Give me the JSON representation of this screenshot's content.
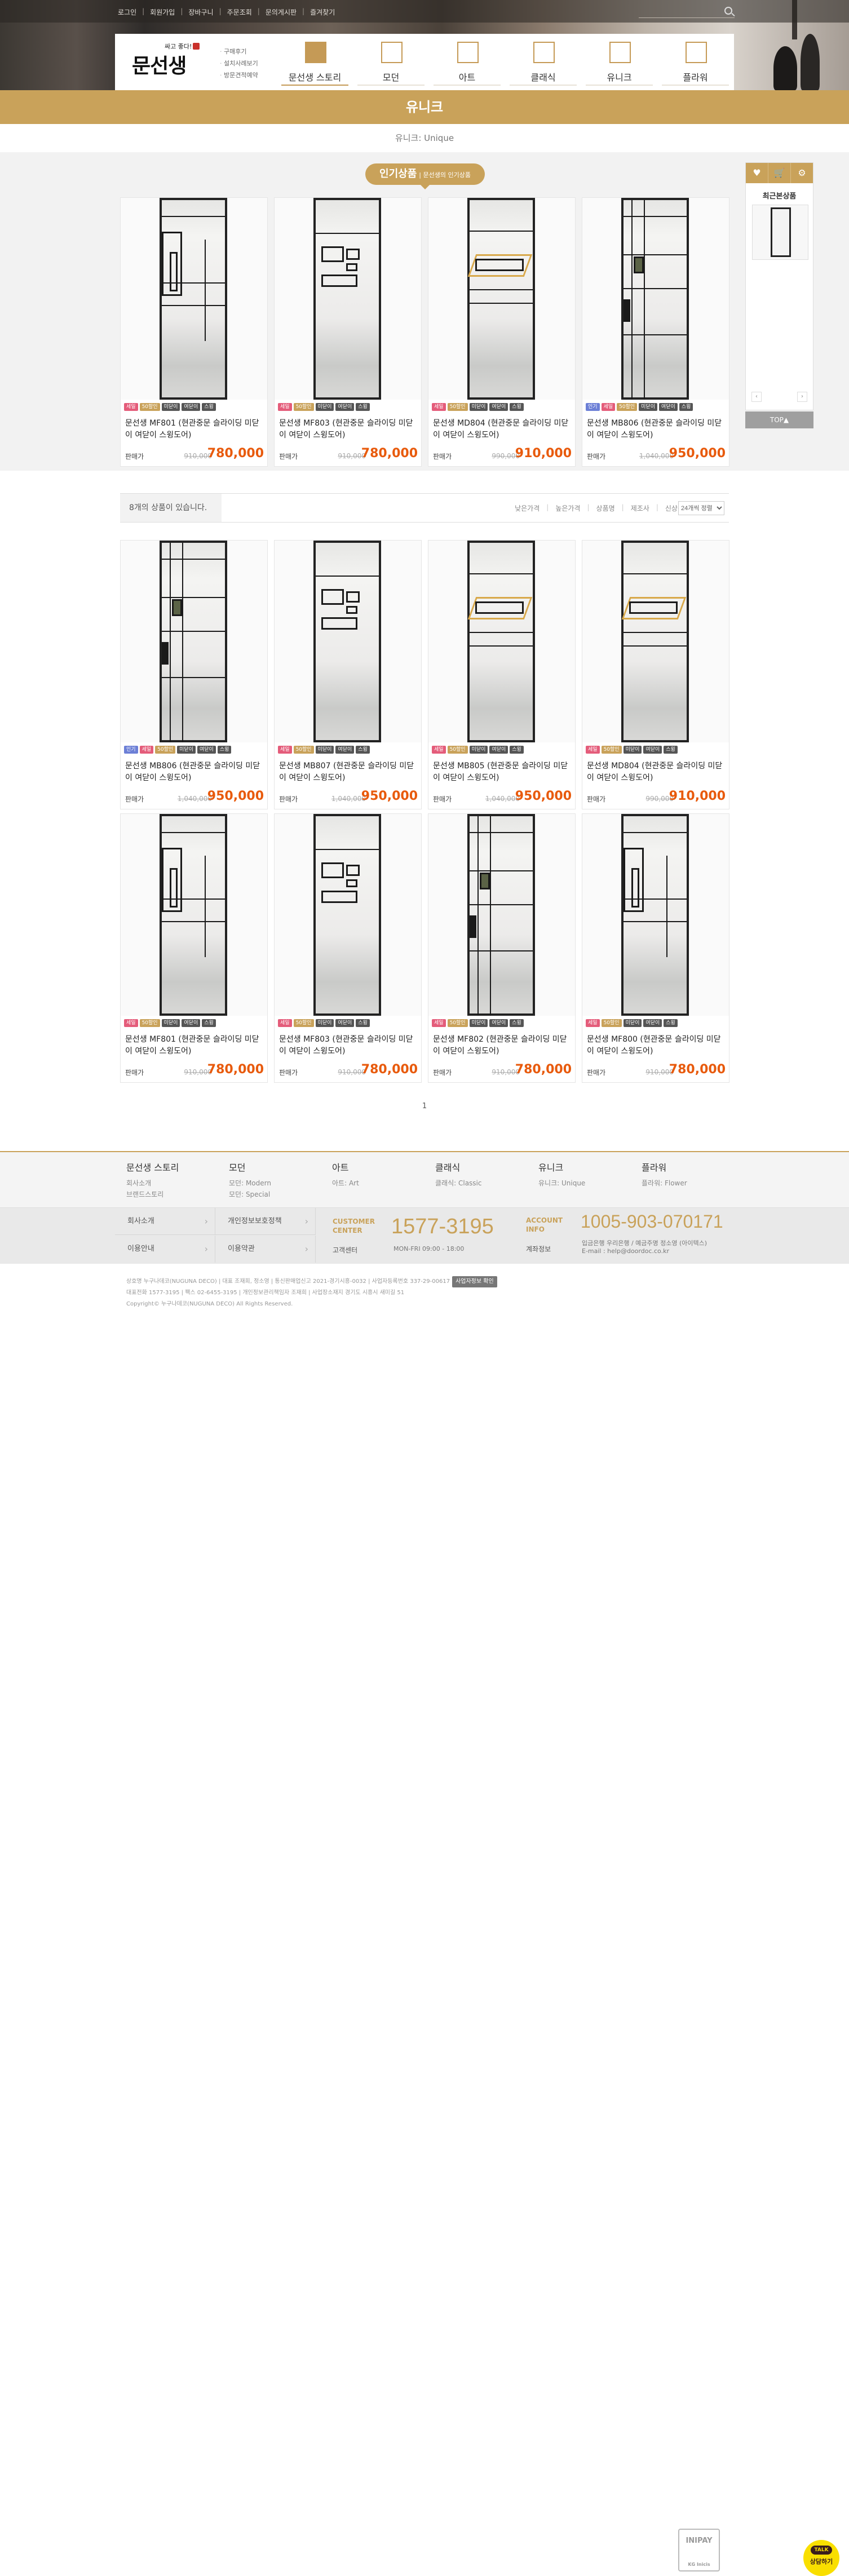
{
  "top_links": [
    "로그인",
    "회원가입",
    "장바구니",
    "주문조회",
    "문의게시판",
    "즐겨찾기"
  ],
  "search": {
    "placeholder": ""
  },
  "logo": {
    "tagline": "싸고 좋다!",
    "name": "문선생"
  },
  "sublinks": [
    "구매후기",
    "설치사례보기",
    "방문견적예약"
  ],
  "menu": [
    {
      "label": "문선생 스토리",
      "active": true
    },
    {
      "label": "모던",
      "active": false
    },
    {
      "label": "아트",
      "active": false
    },
    {
      "label": "클래식",
      "active": false
    },
    {
      "label": "유니크",
      "active": false
    },
    {
      "label": "플라워",
      "active": false
    }
  ],
  "category_title": "유니크",
  "breadcrumb": "유니크: Unique",
  "popular_badge": {
    "main": "인기상품",
    "sub": "| 문선생의 인기상품"
  },
  "price_label": "판매가",
  "popular_products": [
    {
      "name": "문선생 MF801 (현관중문 슬라이딩 미닫이 여닫이 스윙도어)",
      "orig": "910,000",
      "price": "780,000",
      "badges": [
        "세일",
        "50할인",
        "미닫이",
        "여닫이",
        "스윙"
      ]
    },
    {
      "name": "문선생 MF803 (현관중문 슬라이딩 미닫이 여닫이 스윙도어)",
      "orig": "910,000",
      "price": "780,000",
      "badges": [
        "세일",
        "50할인",
        "미닫이",
        "여닫이",
        "스윙"
      ]
    },
    {
      "name": "문선생 MD804 (현관중문 슬라이딩 미닫이 여닫이 스윙도어)",
      "orig": "990,000",
      "price": "910,000",
      "badges": [
        "세일",
        "50할인",
        "미닫이",
        "여닫이",
        "스윙"
      ]
    },
    {
      "name": "문선생 MB806 (현관중문 슬라이딩 미닫이 여닫이 스윙도어)",
      "orig": "1,040,000",
      "price": "950,000",
      "badges": [
        "인기",
        "세일",
        "50할인",
        "미닫이",
        "여닫이",
        "스윙"
      ]
    }
  ],
  "sidebar": {
    "recent_title": "최근본상품",
    "prev": "‹",
    "next": "›",
    "top": "TOP▲"
  },
  "list_count": "8개의 상품이 있습니다.",
  "sort_options": [
    "낮은가격",
    "높은가격",
    "상품명",
    "제조사",
    "신상품"
  ],
  "per_page": "24개씩 정렬",
  "products": [
    {
      "name": "문선생 MB806 (현관중문 슬라이딩 미닫이 여닫이 스윙도어)",
      "orig": "1,040,000",
      "price": "950,000",
      "badges": [
        "인기",
        "세일",
        "50할인",
        "미닫이",
        "여닫이",
        "스윙"
      ]
    },
    {
      "name": "문선생 MB807 (현관중문 슬라이딩 미닫이 여닫이 스윙도어)",
      "orig": "1,040,000",
      "price": "950,000",
      "badges": [
        "세일",
        "50할인",
        "미닫이",
        "여닫이",
        "스윙"
      ]
    },
    {
      "name": "문선생 MB805 (현관중문 슬라이딩 미닫이 여닫이 스윙도어)",
      "orig": "1,040,000",
      "price": "950,000",
      "badges": [
        "세일",
        "50할인",
        "미닫이",
        "여닫이",
        "스윙"
      ]
    },
    {
      "name": "문선생 MD804 (현관중문 슬라이딩 미닫이 여닫이 스윙도어)",
      "orig": "990,000",
      "price": "910,000",
      "badges": [
        "세일",
        "50할인",
        "미닫이",
        "여닫이",
        "스윙"
      ]
    },
    {
      "name": "문선생 MF801 (현관중문 슬라이딩 미닫이 여닫이 스윙도어)",
      "orig": "910,000",
      "price": "780,000",
      "badges": [
        "세일",
        "50할인",
        "미닫이",
        "여닫이",
        "스윙"
      ]
    },
    {
      "name": "문선생 MF803 (현관중문 슬라이딩 미닫이 여닫이 스윙도어)",
      "orig": "910,000",
      "price": "780,000",
      "badges": [
        "세일",
        "50할인",
        "미닫이",
        "여닫이",
        "스윙"
      ]
    },
    {
      "name": "문선생 MF802 (현관중문 슬라이딩 미닫이 여닫이 스윙도어)",
      "orig": "910,000",
      "price": "780,000",
      "badges": [
        "세일",
        "50할인",
        "미닫이",
        "여닫이",
        "스윙"
      ]
    },
    {
      "name": "문선생 MF800 (현관중문 슬라이딩 미닫이 여닫이 스윙도어)",
      "orig": "910,000",
      "price": "780,000",
      "badges": [
        "세일",
        "50할인",
        "미닫이",
        "여닫이",
        "스윙"
      ]
    }
  ],
  "pagination": "1",
  "footer_nav": [
    {
      "title": "문선생 스토리",
      "subs": [
        "회사소개",
        "브랜드스토리"
      ]
    },
    {
      "title": "모던",
      "subs": [
        "모던: Modern",
        "모던: Special"
      ]
    },
    {
      "title": "아트",
      "subs": [
        "아트: Art"
      ]
    },
    {
      "title": "클래식",
      "subs": [
        "클래식: Classic"
      ]
    },
    {
      "title": "유니크",
      "subs": [
        "유니크: Unique"
      ]
    },
    {
      "title": "플라워",
      "subs": [
        "플라워: Flower"
      ]
    }
  ],
  "footer_links": [
    "회사소개",
    "개인정보보호정책",
    "이용안내",
    "이용약관"
  ],
  "customer_center": {
    "label_1": "CUSTOMER",
    "label_2": "CENTER",
    "sub": "고객센터",
    "phone": "1577-3195",
    "hours": "MON-FRI 09:00 - 18:00"
  },
  "account_info": {
    "label_1": "ACCOUNT",
    "label_2": "INFO",
    "sub": "계좌정보",
    "number": "1005-903-070171",
    "bank": "입금은행 우리은행 / 예금주명 정소영 (아이텍스)",
    "email": "E-mail : help@doordoc.co.kr"
  },
  "company_lines": [
    "상호명 누구나데코(NUGUNA DECO) | 대표 조재희, 정소영 | 통신판매업신고 2021-경기시흥-0032 | 사업자등록번호 337-29-00617",
    "대표전화 1577-3195 | 팩스 02-6455-3195 | 개인정보관리책임자 조재희 | 사업장소재지 경기도 시흥시 새미길 51",
    "Copyright© 누구나데코(NUGUNA DECO) All Rights Reserved."
  ],
  "biz_check": "사업자정보 확인",
  "inipay": {
    "name": "INIPAY",
    "sub": "KG Inicis"
  },
  "kakao": {
    "badge": "TALK",
    "label": "상담하기"
  },
  "colors": {
    "accent": "#c9a25a",
    "price": "#e85a0c",
    "badge_sale": "#e45c7a",
    "badge_hot": "#6c7fd6"
  }
}
